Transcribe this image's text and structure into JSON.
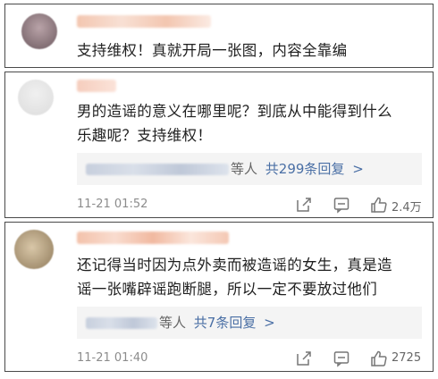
{
  "comments": [
    {
      "text_lines": [
        "支持维权！真就开局一张图，内容全靠编"
      ]
    },
    {
      "text_lines": [
        "男的造谣的意义在哪里呢？到底从中能得到什么",
        "乐趣呢？支持维权！"
      ],
      "reply_summary": {
        "suffix": "等人",
        "count_text": "共299条回复",
        "arrow": ">"
      },
      "time": "11-21 01:52",
      "likes": "2.4万"
    },
    {
      "text_lines": [
        "还记得当时因为点外卖而被造谣的女生，真是造",
        "谣一张嘴辟谣跑断腿，所以一定不要放过他们"
      ],
      "reply_summary": {
        "suffix": "等人",
        "count_text": "共7条回复",
        "arrow": ">"
      },
      "time": "11-21 01:40",
      "likes": "2725"
    }
  ],
  "icons": [
    "share-icon",
    "comment-icon",
    "like-icon"
  ],
  "colors": {
    "link_blue": "#4a6fa5",
    "meta_gray": "#8c8c8c",
    "border": "#4a4a4a"
  }
}
